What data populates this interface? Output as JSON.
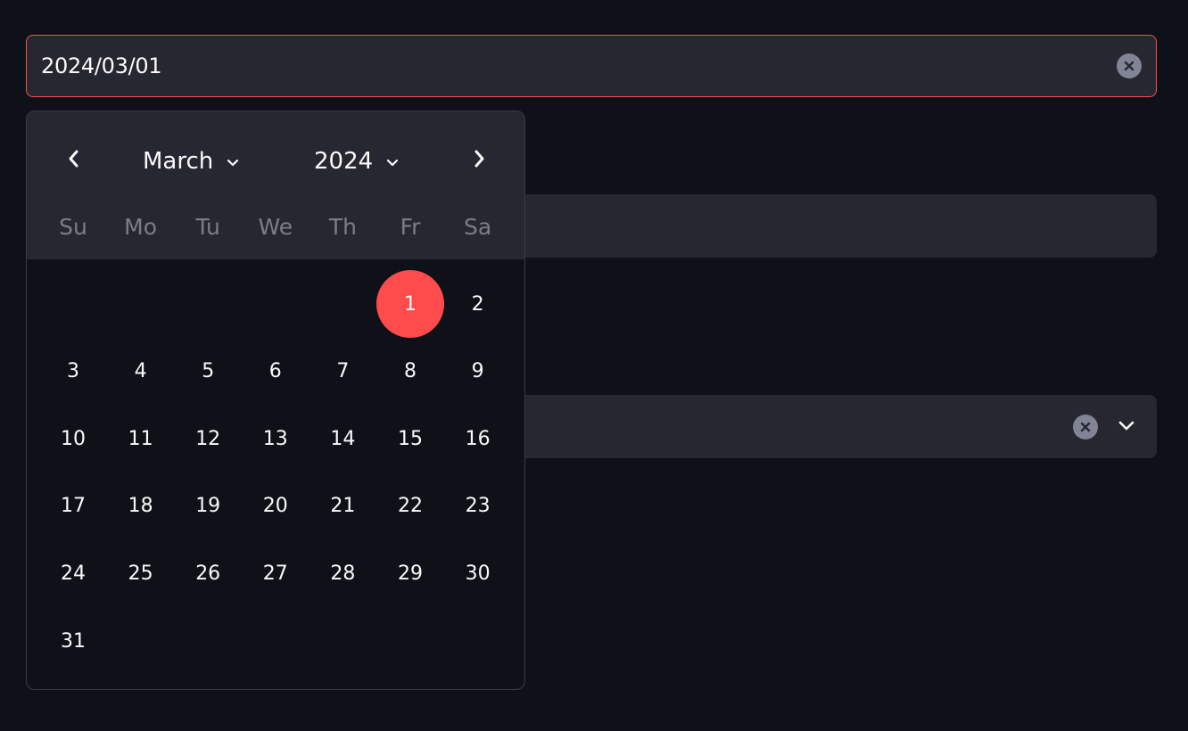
{
  "date_input": {
    "value": "2024/03/01",
    "border_color": "#ff4b4b",
    "clear_icon": "close-circle-icon"
  },
  "calendar": {
    "month_select": {
      "value": "March",
      "icon": "chevron-down-icon"
    },
    "year_select": {
      "value": "2024",
      "icon": "chevron-down-icon"
    },
    "prev_icon": "chevron-left-icon",
    "next_icon": "chevron-right-icon",
    "weekdays": [
      "Su",
      "Mo",
      "Tu",
      "We",
      "Th",
      "Fr",
      "Sa"
    ],
    "first_weekday_index": 5,
    "days": [
      "1",
      "2",
      "3",
      "4",
      "5",
      "6",
      "7",
      "8",
      "9",
      "10",
      "11",
      "12",
      "13",
      "14",
      "15",
      "16",
      "17",
      "18",
      "19",
      "20",
      "21",
      "22",
      "23",
      "24",
      "25",
      "26",
      "27",
      "28",
      "29",
      "30",
      "31"
    ],
    "selected_day": "1",
    "accent_color": "#ff4b4b"
  },
  "select_field": {
    "clear_icon": "close-circle-icon",
    "dropdown_icon": "chevron-down-icon"
  }
}
